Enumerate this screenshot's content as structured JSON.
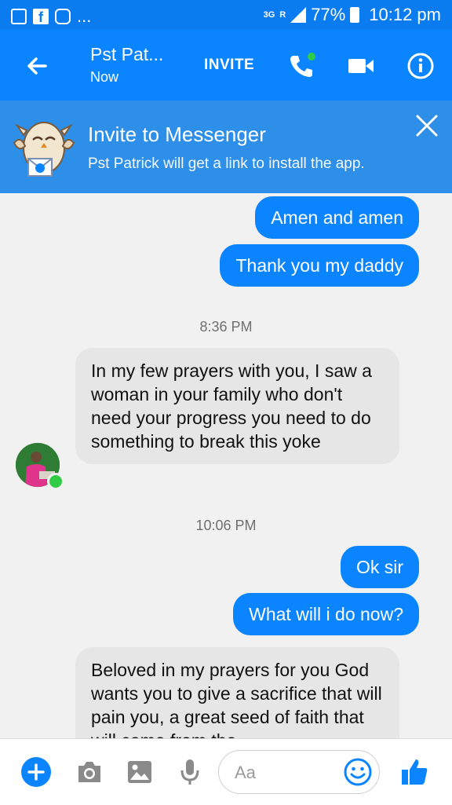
{
  "status_bar": {
    "left_icons": [
      "image-icon",
      "facebook-icon",
      "instagram-icon"
    ],
    "dots": "...",
    "network": "3G",
    "roaming": "R",
    "battery": "77%",
    "time": "10:12 pm"
  },
  "header": {
    "title": "Pst Pat...",
    "subtitle": "Now",
    "invite_label": "INVITE"
  },
  "banner": {
    "title": "Invite to Messenger",
    "subtitle": "Pst Patrick will get a link to install the app."
  },
  "messages": [
    {
      "type": "outgoing",
      "text": "Amen and amen"
    },
    {
      "type": "outgoing",
      "text": "Thank you my daddy"
    },
    {
      "type": "timestamp",
      "text": "8:36 PM"
    },
    {
      "type": "incoming",
      "text": "In my few prayers with you, I saw a woman in your family who don't need your progress you need to do something to break this yoke"
    },
    {
      "type": "timestamp",
      "text": "10:06 PM"
    },
    {
      "type": "outgoing",
      "text": "Ok sir"
    },
    {
      "type": "outgoing",
      "text": "What will i do now?"
    },
    {
      "type": "incoming",
      "text": "Beloved in my prayers for you God wants you to give a sacrifice that will pain you, a great seed of faith that will come from the"
    }
  ],
  "composer": {
    "placeholder": "Aa"
  },
  "colors": {
    "accent": "#0a84ff",
    "banner": "#2e8fe8",
    "online": "#31cc46"
  }
}
